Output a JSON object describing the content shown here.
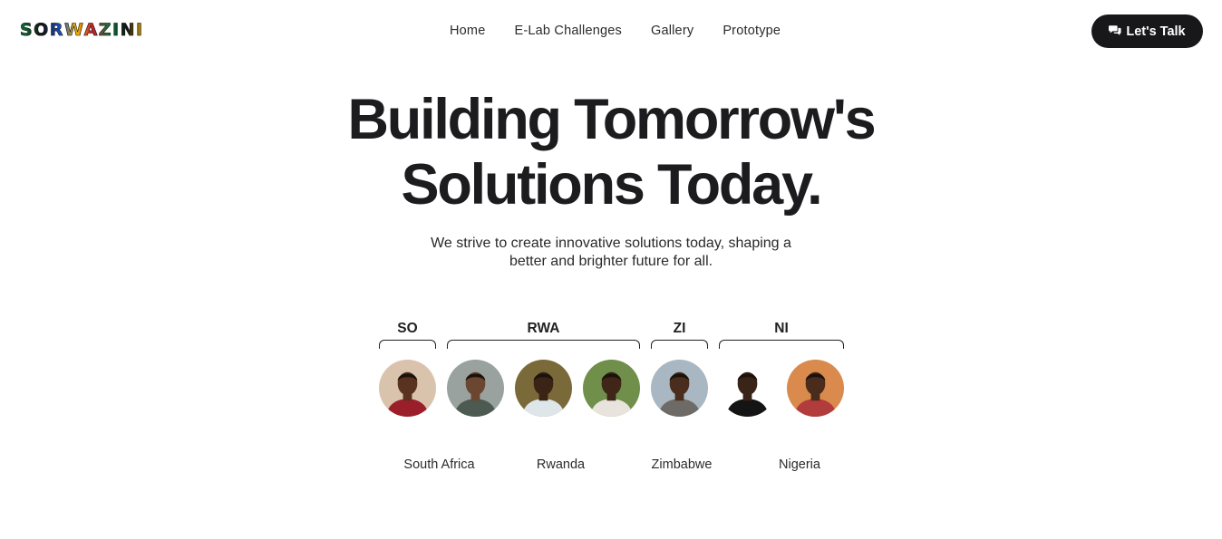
{
  "brand": {
    "logo_text": "SORWAZINI"
  },
  "nav": {
    "items": [
      "Home",
      "E-Lab Challenges",
      "Gallery",
      "Prototype"
    ]
  },
  "cta": {
    "label": "Let's Talk",
    "icon": "chat-bubbles-icon"
  },
  "hero": {
    "title_line1": "Building Tomorrow's",
    "title_line2": "Solutions Today.",
    "subtitle": "We strive to create innovative solutions today, shaping a better and brighter future for all."
  },
  "groups": [
    {
      "label": "SO"
    },
    {
      "label": "RWA"
    },
    {
      "label": "ZI"
    },
    {
      "label": "NI"
    }
  ],
  "countries": [
    {
      "name": "South Africa"
    },
    {
      "name": "Rwanda"
    },
    {
      "name": "Zimbabwe"
    },
    {
      "name": "Nigeria"
    }
  ],
  "team_avatars": [
    {
      "icon": "avatar-photo",
      "bg": "#d9c3ad",
      "skin": "#5a3320",
      "shirt": "#9b1f2a"
    },
    {
      "icon": "avatar-photo",
      "bg": "#9aa2a0",
      "skin": "#6b4630",
      "shirt": "#4c5a52"
    },
    {
      "icon": "avatar-photo",
      "bg": "#7a6a3a",
      "skin": "#3b2416",
      "shirt": "#dfe6ea"
    },
    {
      "icon": "avatar-photo",
      "bg": "#6f8f4a",
      "skin": "#3f2618",
      "shirt": "#e8e3dc"
    },
    {
      "icon": "avatar-photo",
      "bg": "#a9b7c2",
      "skin": "#4a2d1c",
      "shirt": "#6e6b66"
    },
    {
      "icon": "avatar-photo",
      "bg": "#ffffff",
      "skin": "#3a2418",
      "shirt": "#141414"
    },
    {
      "icon": "avatar-photo",
      "bg": "#d98a4c",
      "skin": "#4a2c1c",
      "shirt": "#b23b3b"
    }
  ]
}
